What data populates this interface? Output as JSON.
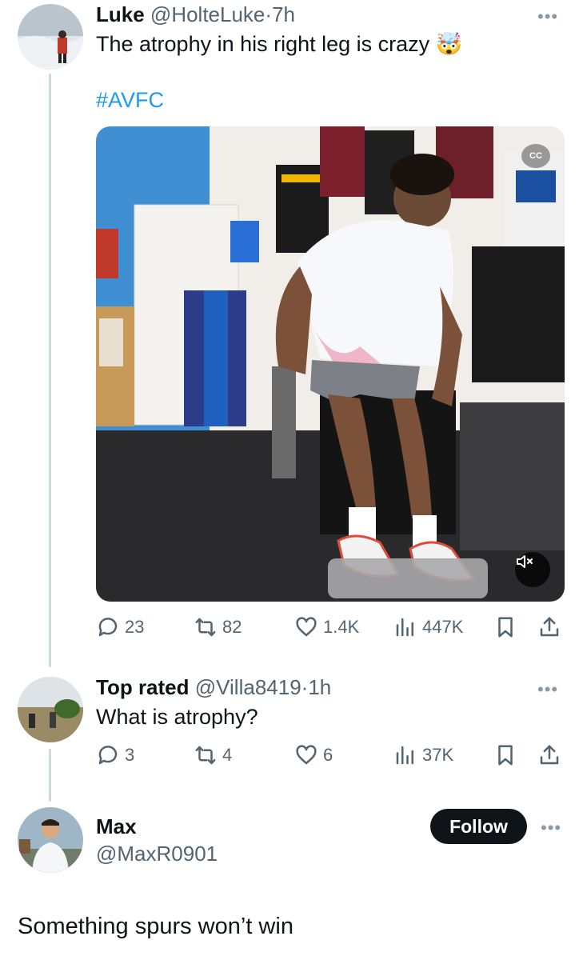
{
  "tweet": {
    "display_name": "Luke",
    "handle": "@HolteLuke",
    "separator": "·",
    "time": "7h",
    "text": "The atrophy in his right leg is crazy",
    "emoji": "🤯",
    "hashtag": "#AVFC",
    "media": {
      "cc_label": "CC"
    },
    "stats": {
      "replies": "23",
      "reposts": "82",
      "likes": "1.4K",
      "views": "447K"
    }
  },
  "reply": {
    "display_name": "Top rated",
    "handle": "@Villa8419",
    "separator": "·",
    "time": "1h",
    "text": "What is atrophy?",
    "stats": {
      "replies": "3",
      "reposts": "4",
      "likes": "6",
      "views": "37K"
    }
  },
  "profile_card": {
    "display_name": "Max",
    "handle": "@MaxR0901",
    "follow_label": "Follow",
    "text": "Something spurs won’t win"
  },
  "more_glyph": "•••",
  "icons": [
    "reply-icon",
    "repost-icon",
    "like-icon",
    "views-icon",
    "bookmark-icon",
    "share-icon",
    "mute-icon",
    "more-icon"
  ],
  "colors": {
    "accent": "#1d9bf0",
    "text": "#0f1419",
    "muted": "#536471",
    "thread_line": "#cfd9de"
  }
}
